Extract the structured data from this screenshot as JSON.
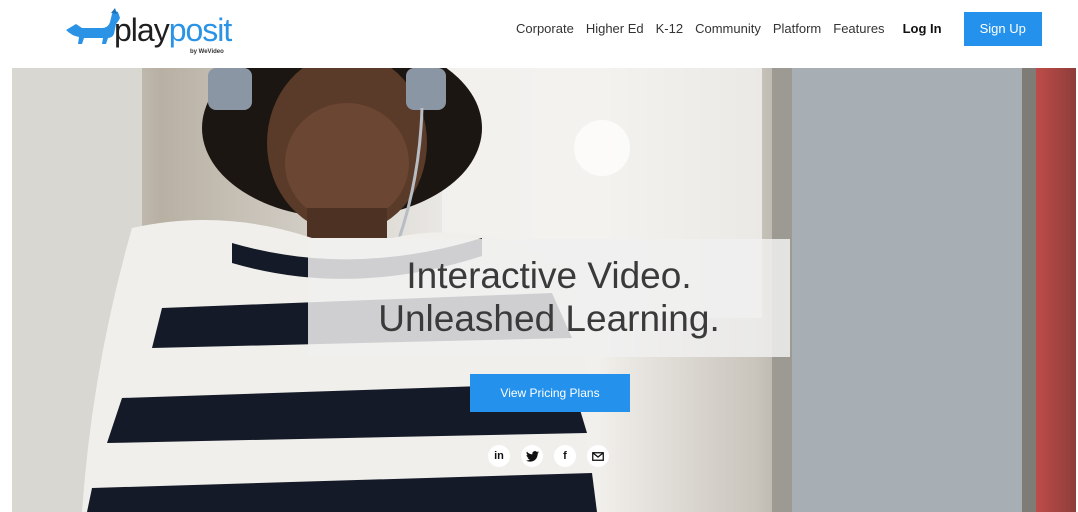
{
  "header": {
    "logo": {
      "text_play": "play",
      "text_posit": "posit",
      "byline": "by WeVideo",
      "icon": "dachshund-logo-icon"
    },
    "nav": [
      {
        "label": "Corporate"
      },
      {
        "label": "Higher Ed"
      },
      {
        "label": "K-12"
      },
      {
        "label": "Community"
      },
      {
        "label": "Platform"
      },
      {
        "label": "Features"
      }
    ],
    "login_label": "Log In",
    "signup_label": "Sign Up"
  },
  "hero": {
    "headline_line1": "Interactive Video.",
    "headline_line2": "Unleashed Learning.",
    "cta_label": "View Pricing Plans",
    "social": [
      {
        "name": "linkedin",
        "glyph": "in",
        "icon": "linkedin-icon"
      },
      {
        "name": "twitter",
        "glyph": "",
        "icon": "twitter-icon"
      },
      {
        "name": "facebook",
        "glyph": "f",
        "icon": "facebook-icon"
      },
      {
        "name": "email",
        "glyph": "",
        "icon": "email-icon"
      }
    ]
  },
  "colors": {
    "accent": "#2492ec",
    "logo_blue": "#2b93e6",
    "headline_text": "#3a3a3a"
  }
}
